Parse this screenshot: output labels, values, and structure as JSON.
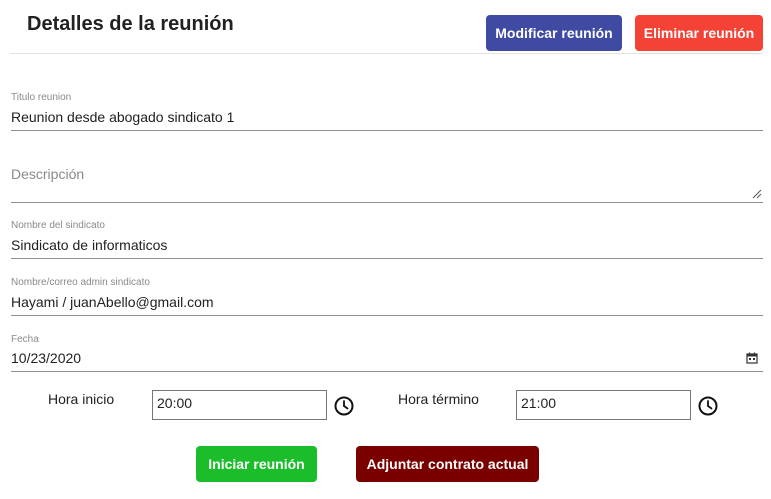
{
  "header": {
    "title": "Detalles de la reunión",
    "modify_label": "Modificar reunión",
    "delete_label": "Eliminar reunión"
  },
  "form": {
    "titulo": {
      "label": "Titulo reunion",
      "value": "Reunion desde abogado sindicato 1"
    },
    "descripcion": {
      "placeholder": "Descripción",
      "value": ""
    },
    "sindicato": {
      "label": "Nombre del sindicato",
      "value": "Sindicato de informaticos"
    },
    "admin": {
      "label": "Nombre/correo admin sindicato",
      "value": "Hayami / juanAbello@gmail.com"
    },
    "fecha": {
      "label": "Fecha",
      "value": "10/23/2020"
    }
  },
  "time": {
    "inicio": {
      "label": "Hora inicio",
      "value": "20:00"
    },
    "termino": {
      "label": "Hora término",
      "value": "21:00"
    }
  },
  "actions": {
    "start_label": "Iniciar reunión",
    "attach_label": "Adjuntar contrato actual"
  },
  "colors": {
    "modify": "#3f4ba3",
    "delete": "#f44336",
    "start": "#1bbd2b",
    "attach": "#7a0000"
  },
  "icons": {
    "date": "calendar-icon",
    "time": "clock-icon",
    "textarea": "resize-grip-icon"
  }
}
